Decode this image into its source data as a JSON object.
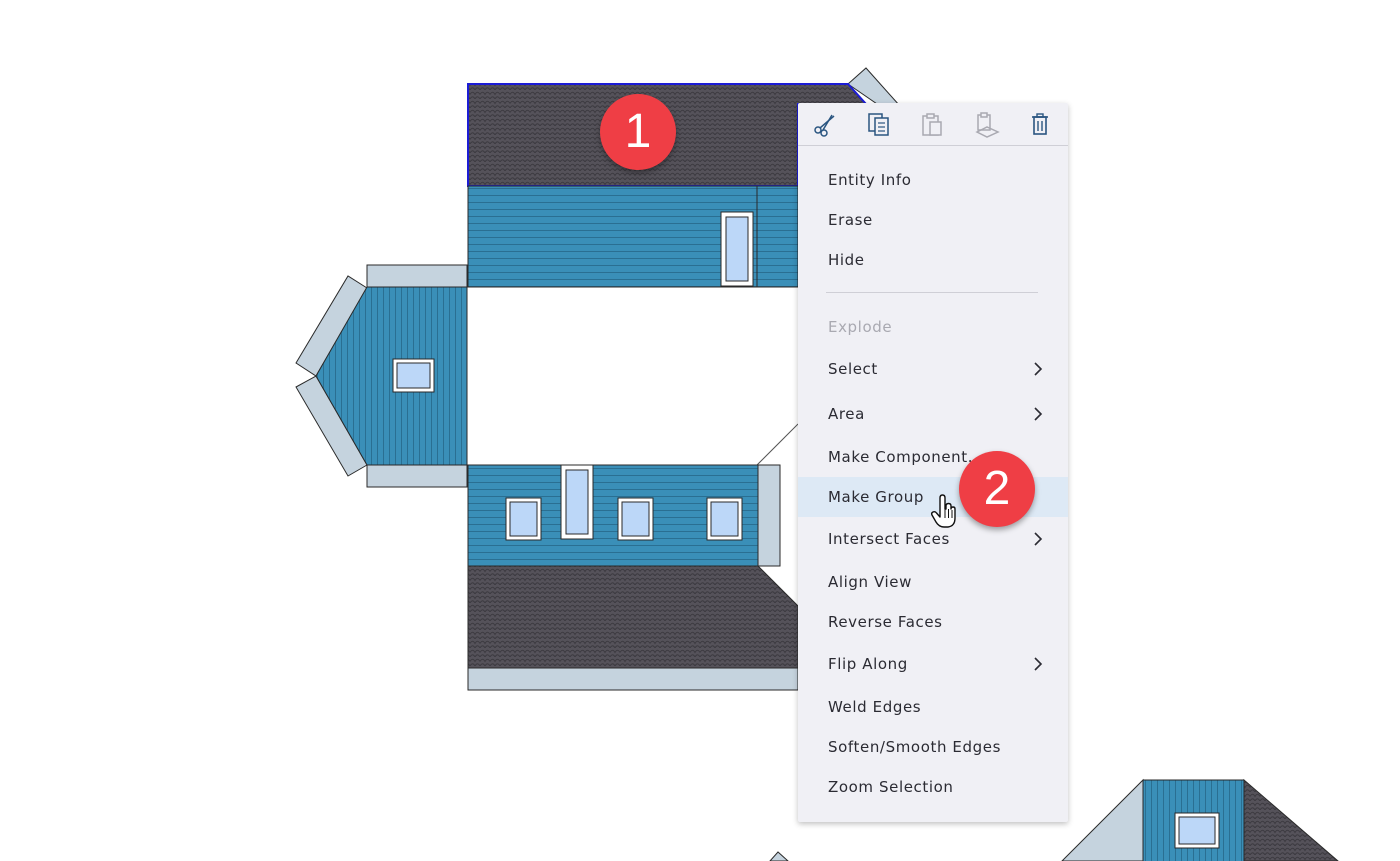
{
  "toolbar": {
    "buttons": [
      {
        "name": "cut",
        "icon": "scissors-icon"
      },
      {
        "name": "copy",
        "icon": "copy-icon"
      },
      {
        "name": "paste",
        "icon": "paste-icon"
      },
      {
        "name": "paste-in-place",
        "icon": "paste-in-place-icon"
      },
      {
        "name": "delete",
        "icon": "trash-icon"
      }
    ]
  },
  "menu": {
    "items": [
      {
        "label": "Entity Info",
        "submenu": false,
        "disabled": false
      },
      {
        "label": "Erase",
        "submenu": false,
        "disabled": false
      },
      {
        "label": "Hide",
        "submenu": false,
        "disabled": false
      },
      {
        "label": "Explode",
        "submenu": false,
        "disabled": true
      },
      {
        "label": "Select",
        "submenu": true,
        "disabled": false
      },
      {
        "label": "Area",
        "submenu": true,
        "disabled": false
      },
      {
        "label": "Make Component...",
        "submenu": false,
        "disabled": false
      },
      {
        "label": "Make Group",
        "submenu": false,
        "disabled": false,
        "highlighted": true
      },
      {
        "label": "Intersect Faces",
        "submenu": true,
        "disabled": false
      },
      {
        "label": "Align View",
        "submenu": false,
        "disabled": false
      },
      {
        "label": "Reverse Faces",
        "submenu": false,
        "disabled": false
      },
      {
        "label": "Flip Along",
        "submenu": true,
        "disabled": false
      },
      {
        "label": "Weld Edges",
        "submenu": false,
        "disabled": false
      },
      {
        "label": "Soften/Smooth Edges",
        "submenu": false,
        "disabled": false
      },
      {
        "label": "Zoom Selection",
        "submenu": false,
        "disabled": false
      }
    ]
  },
  "badges": {
    "step1": "1",
    "step2": "2"
  },
  "colors": {
    "wall_blue": "#3a8fb8",
    "roof_gray": "#55525a",
    "trim": "#c5d3de",
    "window": "#bcd7f8",
    "selection": "#1c1cd6",
    "badge_red": "#ef3e45",
    "menu_bg": "#f0f0f5",
    "menu_hover": "#dde9f5"
  }
}
